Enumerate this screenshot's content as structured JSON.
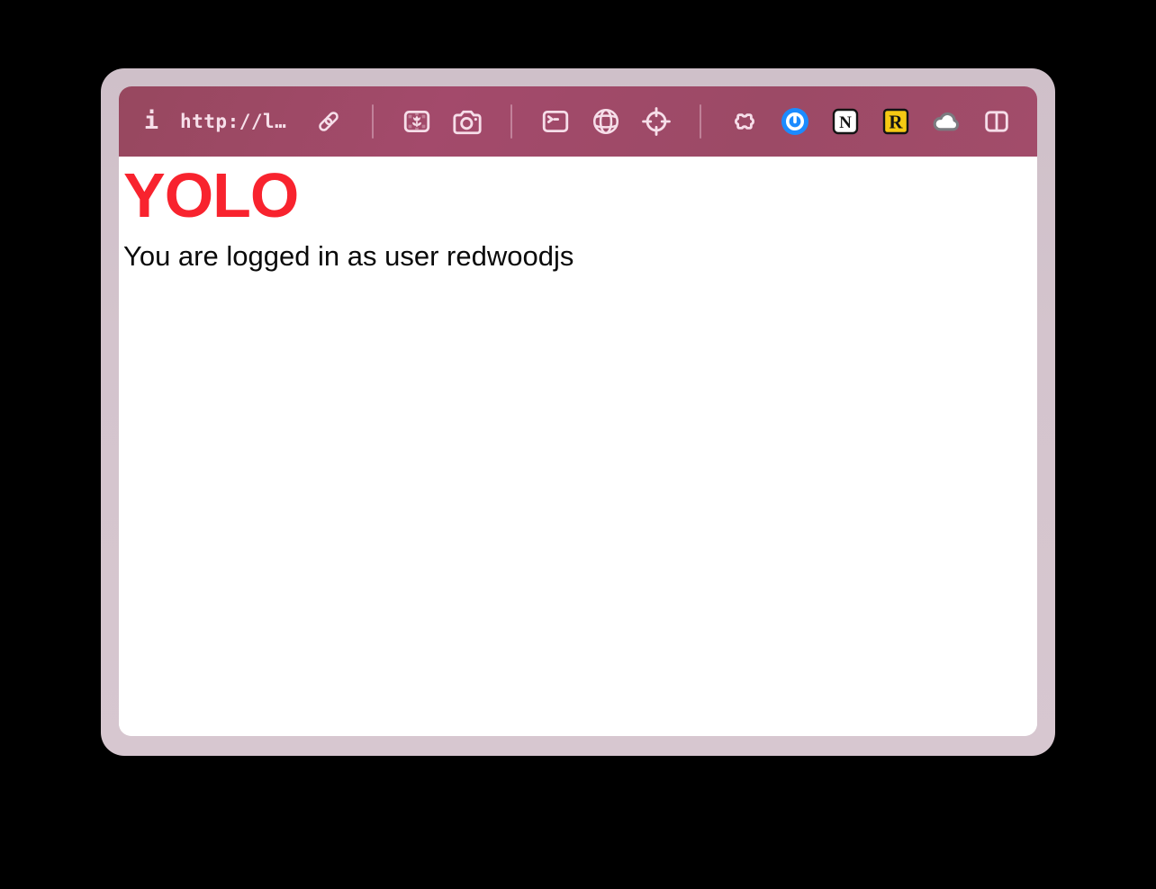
{
  "colors": {
    "desktop_background": "#000000",
    "window_frame": "#d3c3cc",
    "toolbar_background": "#9e4a67",
    "toolbar_icon": "#f6dee9",
    "heading_red": "#f8232e",
    "onepassword_blue": "#1b8bff",
    "readwise_yellow": "#f6c913",
    "cloud_gray": "#7b7b80"
  },
  "toolbar": {
    "info_glyph": "i",
    "url_text": "http://l…",
    "icon_names": [
      "info",
      "link",
      "image",
      "camera",
      "terminal",
      "globe",
      "crosshair",
      "puzzle-extensions",
      "onepassword",
      "notion",
      "readwise",
      "cloud",
      "split-view"
    ]
  },
  "extensions": {
    "notion_letter": "N",
    "readwise_letter": "R"
  },
  "content": {
    "heading": "YOLO",
    "message": "You are logged in as user redwoodjs"
  }
}
